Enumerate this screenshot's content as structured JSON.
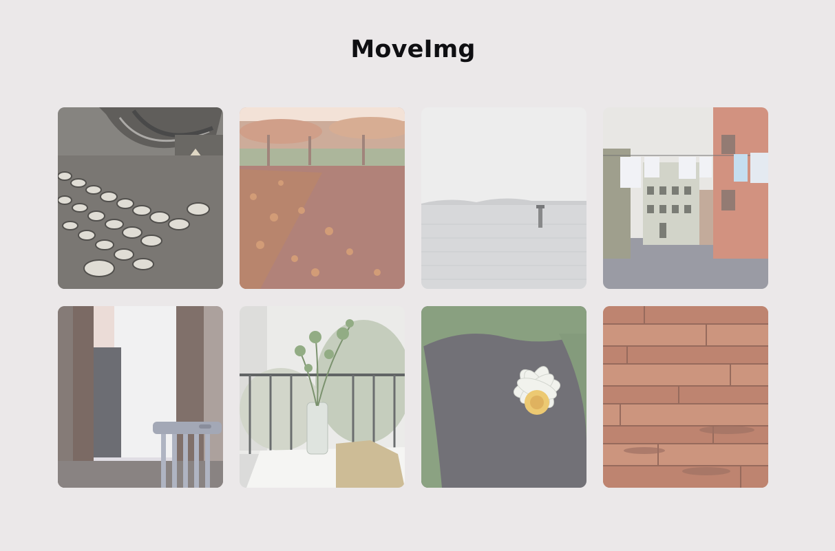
{
  "page": {
    "title": "MoveImg"
  },
  "gallery": {
    "items": [
      {
        "subject": "typewriter"
      },
      {
        "subject": "autumn-path"
      },
      {
        "subject": "misty-sea"
      },
      {
        "subject": "street-laundry"
      },
      {
        "subject": "window-chair"
      },
      {
        "subject": "flower-vase"
      },
      {
        "subject": "water-lily"
      },
      {
        "subject": "wood-planks"
      }
    ]
  },
  "colors": {
    "background": "#ebe8e9",
    "title": "#0f0f12"
  }
}
